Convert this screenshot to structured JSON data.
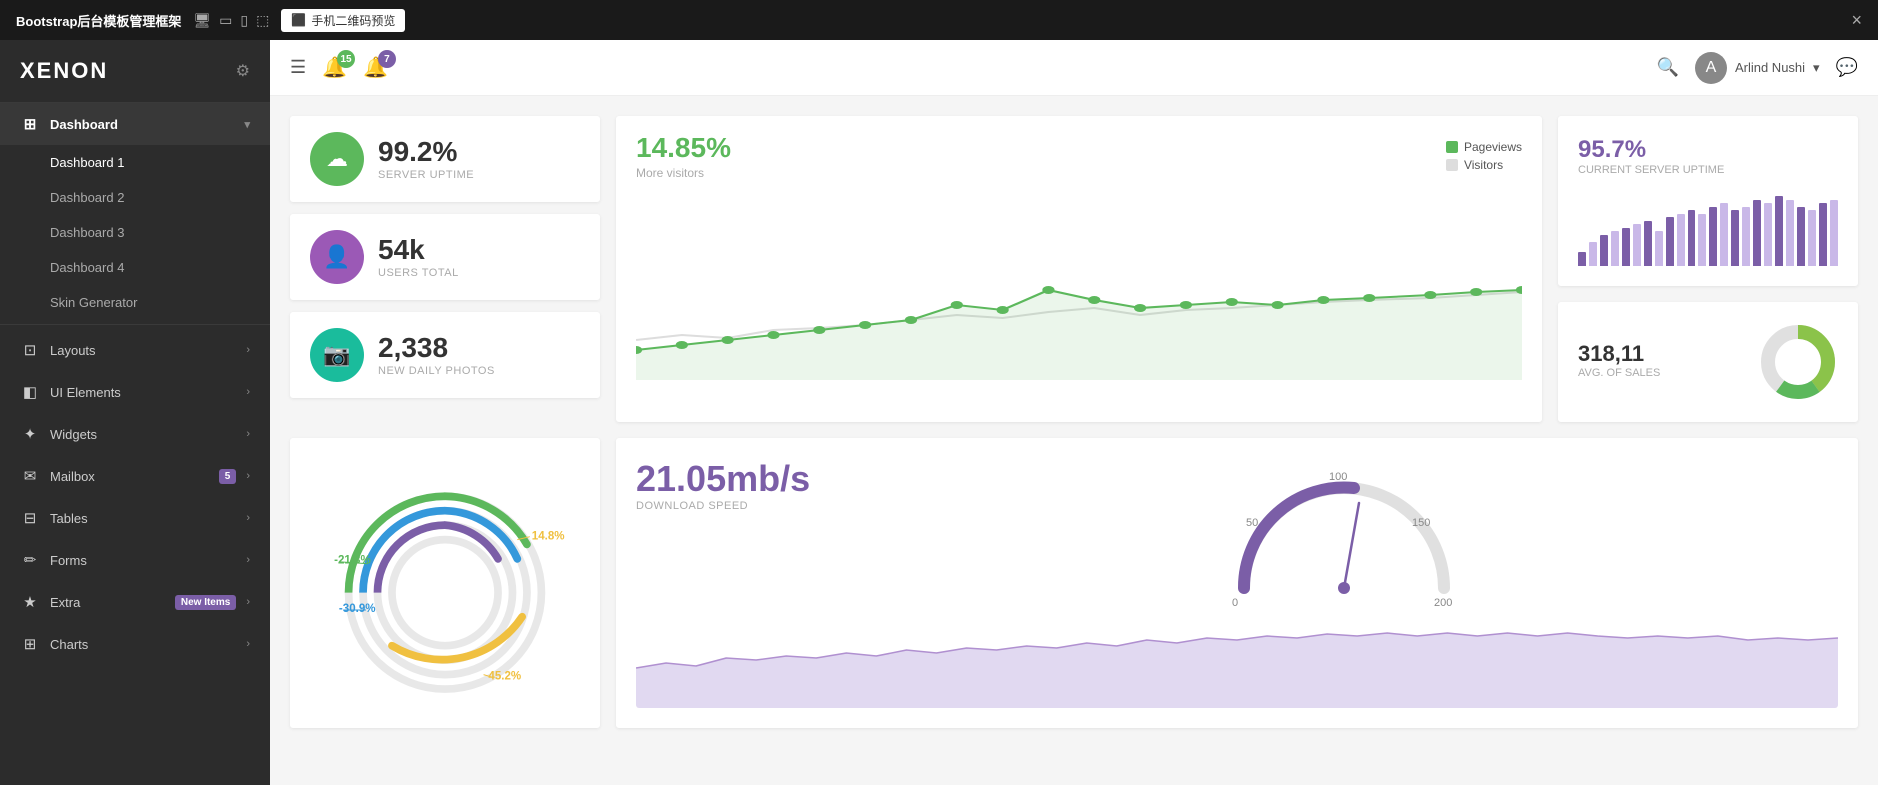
{
  "topbar": {
    "title": "Bootstrap后台模板管理框架",
    "icons": [
      "monitor",
      "square",
      "square-sm",
      "tablet",
      "desktop"
    ],
    "qr_label": "手机二维码预览",
    "close_label": "×"
  },
  "sidebar": {
    "logo": "XENON",
    "gear_icon": "⚙",
    "items": [
      {
        "id": "dashboard",
        "icon": "⊞",
        "label": "Dashboard",
        "arrow": "▾",
        "active": true
      },
      {
        "id": "dashboard1",
        "label": "Dashboard 1",
        "sub": true,
        "active": true
      },
      {
        "id": "dashboard2",
        "label": "Dashboard 2",
        "sub": true
      },
      {
        "id": "dashboard3",
        "label": "Dashboard 3",
        "sub": true
      },
      {
        "id": "dashboard4",
        "label": "Dashboard 4",
        "sub": true
      },
      {
        "id": "skin-gen",
        "label": "Skin Generator",
        "sub": true
      },
      {
        "id": "layouts",
        "icon": "⊡",
        "label": "Layouts",
        "arrow": "›"
      },
      {
        "id": "ui-elements",
        "icon": "◧",
        "label": "UI Elements",
        "arrow": "›"
      },
      {
        "id": "widgets",
        "icon": "✦",
        "label": "Widgets",
        "arrow": "›"
      },
      {
        "id": "mailbox",
        "icon": "✉",
        "label": "Mailbox",
        "arrow": "›",
        "badge": "5"
      },
      {
        "id": "tables",
        "icon": "⊟",
        "label": "Tables",
        "arrow": "›"
      },
      {
        "id": "forms",
        "icon": "✏",
        "label": "Forms",
        "arrow": "›"
      },
      {
        "id": "extra",
        "icon": "★",
        "label": "Extra",
        "arrow": "›",
        "badge_label": "New Items"
      },
      {
        "id": "charts",
        "icon": "⊞",
        "label": "Charts",
        "arrow": "›"
      }
    ]
  },
  "header": {
    "menu_icon": "☰",
    "notifications": [
      {
        "count": "15",
        "color": "green"
      },
      {
        "count": "7",
        "color": "purple"
      }
    ],
    "search_icon": "🔍",
    "user_name": "Arlind Nushi",
    "user_arrow": "▾",
    "chat_icon": "💬"
  },
  "stats": [
    {
      "id": "uptime",
      "value": "99.2%",
      "label": "SERVER UPTIME",
      "icon": "☁",
      "color": "green"
    },
    {
      "id": "users",
      "value": "54k",
      "label": "USERS TOTAL",
      "icon": "👤",
      "color": "purple"
    },
    {
      "id": "photos",
      "value": "2,338",
      "label": "NEW DAILY PHOTOS",
      "icon": "📷",
      "color": "cyan"
    }
  ],
  "line_chart": {
    "percent": "14.85%",
    "subtitle": "More visitors",
    "legend": [
      {
        "label": "Pageviews",
        "color": "green"
      },
      {
        "label": "Visitors",
        "color": "gray"
      }
    ]
  },
  "server_uptime": {
    "value": "95.7%",
    "label": "CURRENT SERVER UPTIME",
    "bars": [
      20,
      35,
      45,
      50,
      55,
      60,
      65,
      50,
      70,
      75,
      80,
      75,
      85,
      90,
      80,
      85,
      95,
      90,
      100,
      95,
      85,
      80,
      90,
      95
    ]
  },
  "avg_sales": {
    "value": "318,11",
    "label": "AVG. OF SALES",
    "donut": {
      "green": 65,
      "lightgreen": 20,
      "darkgreen": 15
    }
  },
  "download": {
    "value": "21.05mb/s",
    "label": "DOWNLOAD SPEED",
    "gauge_max": 200,
    "gauge_value": 105,
    "gauge_labels": [
      "0",
      "50",
      "100",
      "150",
      "200"
    ]
  },
  "ring_chart": {
    "segments": [
      {
        "label": "14.8%",
        "color": "#f0c040",
        "value": 14.8
      },
      {
        "label": "-21.3%",
        "color": "#5cb85c",
        "value": 21.3
      },
      {
        "label": "-30.9%",
        "color": "#3498db",
        "value": 30.9
      },
      {
        "label": "45.2%",
        "color": "#f0c040",
        "value": 45.2
      }
    ]
  }
}
